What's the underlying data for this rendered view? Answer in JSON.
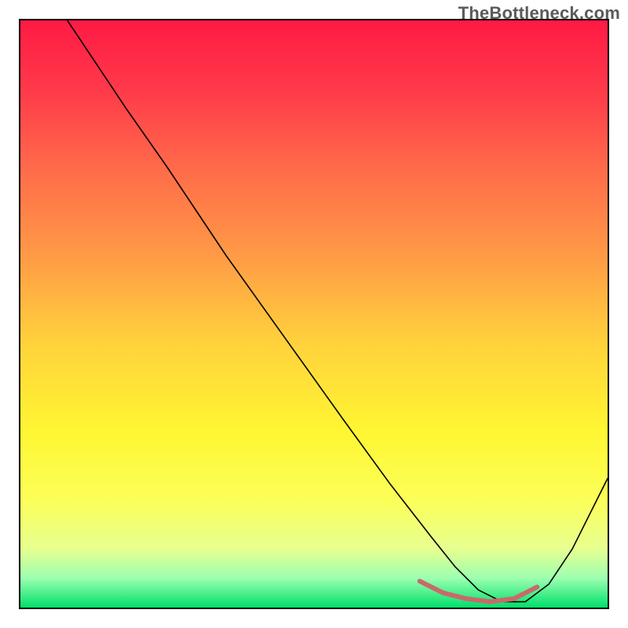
{
  "watermark": "TheBottleneck.com",
  "chart_data": {
    "type": "line",
    "title": "",
    "xlabel": "",
    "ylabel": "",
    "xlim": [
      0,
      100
    ],
    "ylim": [
      0,
      100
    ],
    "gradient_bands": [
      {
        "stop": 0.0,
        "color": "#ff1a44"
      },
      {
        "stop": 0.12,
        "color": "#ff3a4a"
      },
      {
        "stop": 0.25,
        "color": "#ff6a4a"
      },
      {
        "stop": 0.4,
        "color": "#ff9a46"
      },
      {
        "stop": 0.55,
        "color": "#ffd23c"
      },
      {
        "stop": 0.7,
        "color": "#fff632"
      },
      {
        "stop": 0.82,
        "color": "#fbff5a"
      },
      {
        "stop": 0.9,
        "color": "#e6ff90"
      },
      {
        "stop": 0.95,
        "color": "#9cffb0"
      },
      {
        "stop": 1.0,
        "color": "#00e06a"
      }
    ],
    "series": [
      {
        "name": "bottleneck-curve",
        "stroke": "#000000",
        "stroke_width": 1.6,
        "x": [
          8,
          12,
          18,
          25,
          35,
          45,
          55,
          63,
          70,
          74,
          78,
          82,
          86,
          90,
          94,
          100
        ],
        "y": [
          100,
          94,
          85,
          75,
          60,
          46,
          32,
          21,
          12,
          7,
          3,
          1,
          1,
          4,
          10,
          22
        ]
      },
      {
        "name": "optimal-region",
        "stroke": "#c86a6a",
        "stroke_width": 6,
        "x": [
          68,
          72,
          76,
          80,
          84,
          88
        ],
        "y": [
          4.5,
          2.5,
          1.5,
          1.0,
          1.5,
          3.5
        ]
      }
    ]
  }
}
